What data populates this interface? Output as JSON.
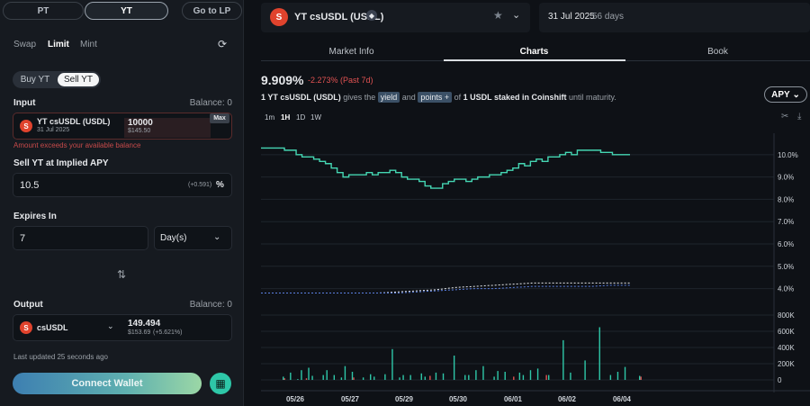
{
  "left": {
    "top_tabs": [
      "PT",
      "YT",
      "Go to LP"
    ],
    "modes": [
      "Swap",
      "Limit",
      "Mint"
    ],
    "side": [
      "Buy YT",
      "Sell YT"
    ],
    "input": {
      "label": "Input",
      "balance": "Balance: 0",
      "token": "YT csUSDL (USDL)",
      "date": "31 Jul 2025",
      "amount": "10000",
      "usd": "$145.50",
      "max": "Max",
      "error": "Amount exceeds your available balance"
    },
    "implied": {
      "label": "Sell YT at Implied APY",
      "value": "10.5",
      "delta": "(+0.591)",
      "unit": "%"
    },
    "expires": {
      "label": "Expires In",
      "value": "7",
      "unit": "Day(s)"
    },
    "output": {
      "label": "Output",
      "balance": "Balance: 0",
      "token": "csUSDL",
      "amount": "149.494",
      "usd": "$153.69",
      "delta": "(+5.621%)"
    },
    "last_updated": "Last updated 25 seconds ago",
    "connect": "Connect Wallet"
  },
  "header": {
    "market": "YT csUSDL (USDL)",
    "date": "31 Jul 2025",
    "days": "56 days"
  },
  "tabs": [
    "Market Info",
    "Charts",
    "Book"
  ],
  "apy": {
    "value": "9.909%",
    "change": "-2.273% (Past 7d)",
    "desc_1": "1 YT csUSDL (USDL)",
    "desc_2": "gives the",
    "yield": "yield",
    "and": "and",
    "points": "points +",
    "desc_3": "of",
    "desc_4": "1 USDL staked in Coinshift",
    "desc_5": "until maturity.",
    "selector": "APY"
  },
  "timeframes": [
    "1m",
    "1H",
    "1D",
    "1W"
  ],
  "colors": {
    "accent": "#2ec7a8",
    "negative": "#e05252",
    "line": "#45d6b3",
    "dashed_white": "#e6e8eb",
    "dashed_blue": "#5b7fe0"
  },
  "chart_data": {
    "type": "line",
    "x_ticks": [
      "05/26",
      "05/27",
      "05/29",
      "05/30",
      "06/01",
      "06/02",
      "06/04"
    ],
    "y_ticks": [
      "10.0%",
      "9.0%",
      "8.0%",
      "7.0%",
      "6.0%",
      "5.0%",
      "4.0%"
    ],
    "ylim": [
      3.5,
      10.8
    ],
    "series": [
      {
        "values": [
          10.3,
          10.3,
          10.3,
          10.3,
          10.2,
          10.2,
          10.0,
          9.9,
          9.9,
          9.8,
          9.7,
          9.6,
          9.4,
          9.2,
          9.0,
          9.1,
          9.1,
          9.1,
          9.2,
          9.1,
          9.2,
          9.2,
          9.3,
          9.2,
          9.0,
          8.9,
          8.9,
          8.8,
          8.6,
          8.5,
          8.5,
          8.7,
          8.8,
          8.9,
          8.9,
          8.8,
          8.9,
          9.0,
          9.0,
          9.1,
          9.1,
          9.2,
          9.3,
          9.4,
          9.6,
          9.5,
          9.7,
          9.8,
          9.7,
          9.9,
          9.9,
          10.0,
          10.1,
          10.0,
          10.2,
          10.2,
          10.2,
          10.2,
          10.1,
          10.1,
          10.0,
          10.0,
          10.0,
          10.0
        ]
      },
      {
        "values": [
          3.8,
          3.8,
          3.8,
          3.8,
          3.8,
          3.8,
          3.8,
          3.85,
          3.9,
          3.95,
          4.05,
          4.1,
          4.15,
          4.2,
          4.25,
          4.25,
          4.25,
          4.25,
          4.25,
          4.25
        ]
      },
      {
        "values": [
          3.8,
          3.8,
          3.8,
          3.8,
          3.8,
          3.8,
          3.8,
          3.8,
          3.85,
          3.9,
          3.95,
          4.0,
          4.0,
          4.05,
          4.1,
          4.1,
          4.1,
          4.1,
          4.15,
          4.15
        ]
      }
    ],
    "volume_ticks": [
      "800K",
      "600K",
      "400K",
      "200K",
      "0"
    ],
    "volume_ylim": [
      0,
      800
    ],
    "volume_teal": [
      0,
      40,
      0,
      90,
      0,
      10,
      120,
      0,
      150,
      50,
      0,
      0,
      60,
      120,
      0,
      60,
      0,
      30,
      170,
      0,
      100,
      0,
      0,
      30,
      0,
      70,
      40,
      0,
      0,
      70,
      0,
      380,
      0,
      30,
      60,
      0,
      60,
      0,
      0,
      80,
      40,
      0,
      0,
      90,
      0,
      80,
      0,
      0,
      300,
      0,
      0,
      60,
      60,
      0,
      120,
      0,
      170,
      0,
      0,
      40,
      110,
      0,
      100,
      0,
      0,
      0,
      90,
      60,
      0,
      120,
      0,
      140,
      0,
      0,
      60,
      0,
      0,
      0,
      490,
      0,
      90,
      0,
      0,
      0,
      240,
      0,
      0,
      0,
      650,
      0,
      0,
      60,
      0,
      100,
      0,
      160,
      0,
      0,
      0,
      50
    ],
    "volume_red": [
      0,
      20,
      0,
      0,
      0,
      0,
      0,
      20,
      0,
      0,
      0,
      0,
      0,
      0,
      0,
      0,
      0,
      0,
      0,
      0,
      30,
      0,
      0,
      0,
      0,
      0,
      0,
      0,
      0,
      0,
      0,
      0,
      0,
      0,
      0,
      0,
      0,
      0,
      0,
      0,
      0,
      50,
      0,
      0,
      0,
      0,
      0,
      0,
      0,
      0,
      0,
      0,
      0,
      0,
      0,
      0,
      0,
      0,
      0,
      0,
      0,
      0,
      0,
      0,
      40,
      0,
      0,
      0,
      0,
      0,
      0,
      0,
      0,
      60,
      0,
      0,
      0,
      0,
      0,
      0,
      0,
      0,
      0,
      0,
      0,
      0,
      0,
      0,
      0,
      0,
      0,
      0,
      0,
      0,
      0,
      0,
      0,
      0,
      0,
      40
    ]
  }
}
